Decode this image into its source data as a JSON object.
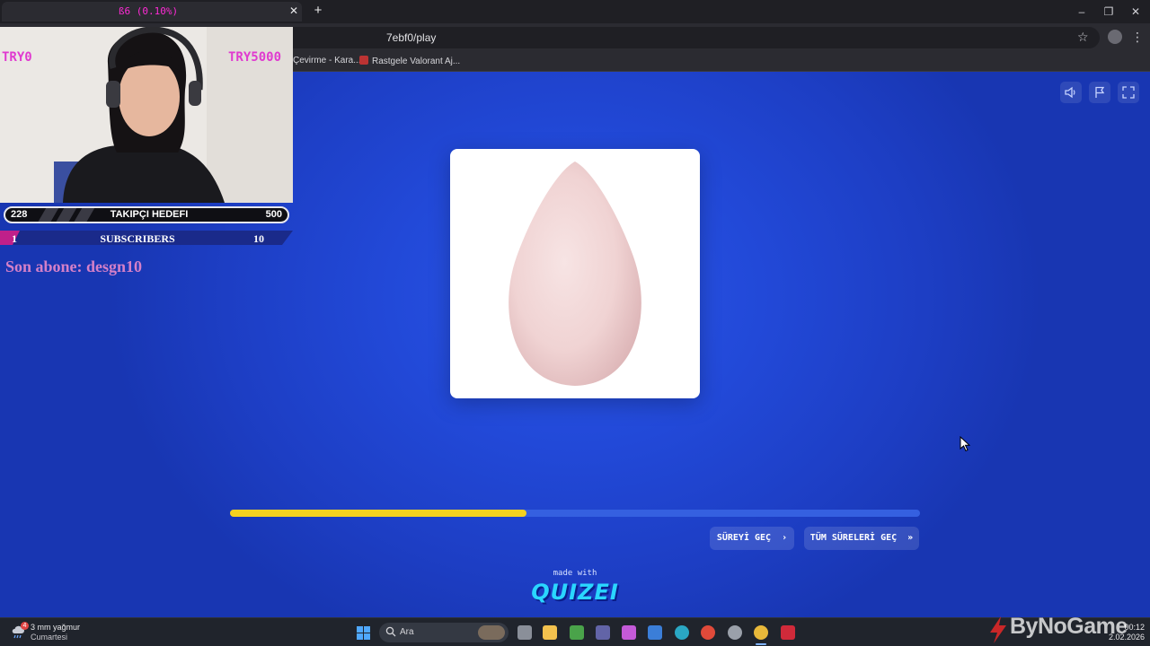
{
  "browser": {
    "tab_title": "ß6 (0.10%)",
    "new_tab_symbol": "+",
    "url": "7ebf0/play",
    "bookmarks": [
      {
        "label": "Çevirme - Kara..."
      },
      {
        "label": "Rastgele Valorant Aj..."
      }
    ]
  },
  "quiz": {
    "image_alt": "pink makeup sponge",
    "progress": 0.43,
    "skip_timer_label": "SÜREYİ GEÇ",
    "skip_all_label": "TÜM SÜRELERİ GEÇ",
    "made_with": "made with",
    "brand": "QUIZEI",
    "colors": {
      "background": "#2249d8",
      "progress_fill": "#f4d21f",
      "progress_track": "#3560e0",
      "brand": "#2ad6ff"
    }
  },
  "overlay": {
    "cam_label_left": "TRY0",
    "cam_label_right": "TRY5000",
    "follower_goal": {
      "current": "228",
      "title": "TAKIPÇI HEDEFI",
      "target": "500"
    },
    "subscribers": {
      "current": "1",
      "title": "SUBSCRIBERS",
      "target": "10"
    },
    "last_subscriber": "Son abone: desgn10",
    "colors": {
      "accent": "#e03ad0",
      "last_sub": "#d480c8"
    }
  },
  "taskbar": {
    "weather_badge": "4",
    "weather_temp": "3 mm yağmur",
    "weather_day": "Cumartesi",
    "search_placeholder": "Ara",
    "time": "00:12",
    "date": "2.02.2026",
    "watermark": "ByNoGame"
  }
}
